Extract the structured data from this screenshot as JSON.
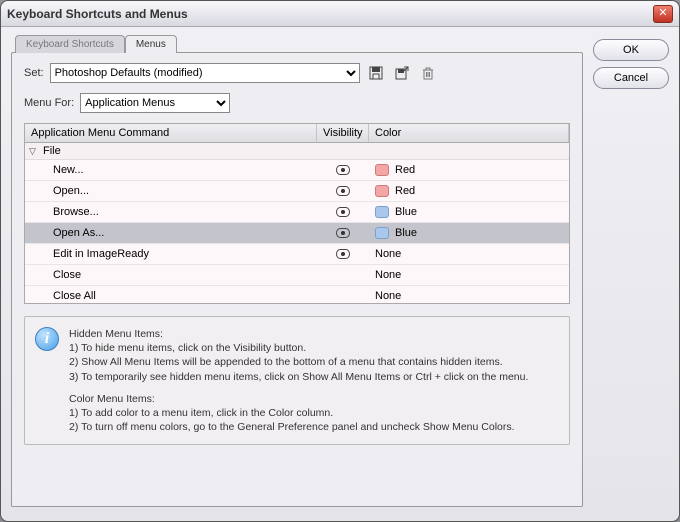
{
  "window": {
    "title": "Keyboard Shortcuts and Menus"
  },
  "buttons": {
    "ok": "OK",
    "cancel": "Cancel"
  },
  "tabs": {
    "shortcuts": "Keyboard Shortcuts",
    "menus": "Menus"
  },
  "set": {
    "label": "Set:",
    "value": "Photoshop Defaults (modified)"
  },
  "menuFor": {
    "label": "Menu For:",
    "value": "Application Menus"
  },
  "columns": {
    "cmd": "Application Menu Command",
    "vis": "Visibility",
    "color": "Color"
  },
  "group": {
    "name": "File"
  },
  "rows": [
    {
      "cmd": "New...",
      "visible": true,
      "color_swatch": "red",
      "color_label": "Red",
      "selected": false
    },
    {
      "cmd": "Open...",
      "visible": true,
      "color_swatch": "red",
      "color_label": "Red",
      "selected": false
    },
    {
      "cmd": "Browse...",
      "visible": true,
      "color_swatch": "blue",
      "color_label": "Blue",
      "selected": false
    },
    {
      "cmd": "Open As...",
      "visible": true,
      "color_swatch": "blue",
      "color_label": "Blue",
      "selected": true
    },
    {
      "cmd": "Edit in ImageReady",
      "visible": true,
      "color_swatch": "",
      "color_label": "None",
      "selected": false
    },
    {
      "cmd": "Close",
      "visible": false,
      "color_swatch": "",
      "color_label": "None",
      "selected": false
    },
    {
      "cmd": "Close All",
      "visible": false,
      "color_swatch": "",
      "color_label": "None",
      "selected": false
    }
  ],
  "info": {
    "hidden_title": "Hidden Menu Items:",
    "hidden_1": "1) To hide menu items, click on the Visibility button.",
    "hidden_2": "2) Show All Menu Items will be appended to the bottom of a menu that contains hidden items.",
    "hidden_3": "3) To temporarily see hidden menu items, click on Show All Menu Items or Ctrl + click on the menu.",
    "color_title": "Color Menu Items:",
    "color_1": "1) To add color to a menu item, click in the Color column.",
    "color_2": "2) To turn off menu colors, go to the General Preference panel and uncheck Show Menu Colors."
  }
}
